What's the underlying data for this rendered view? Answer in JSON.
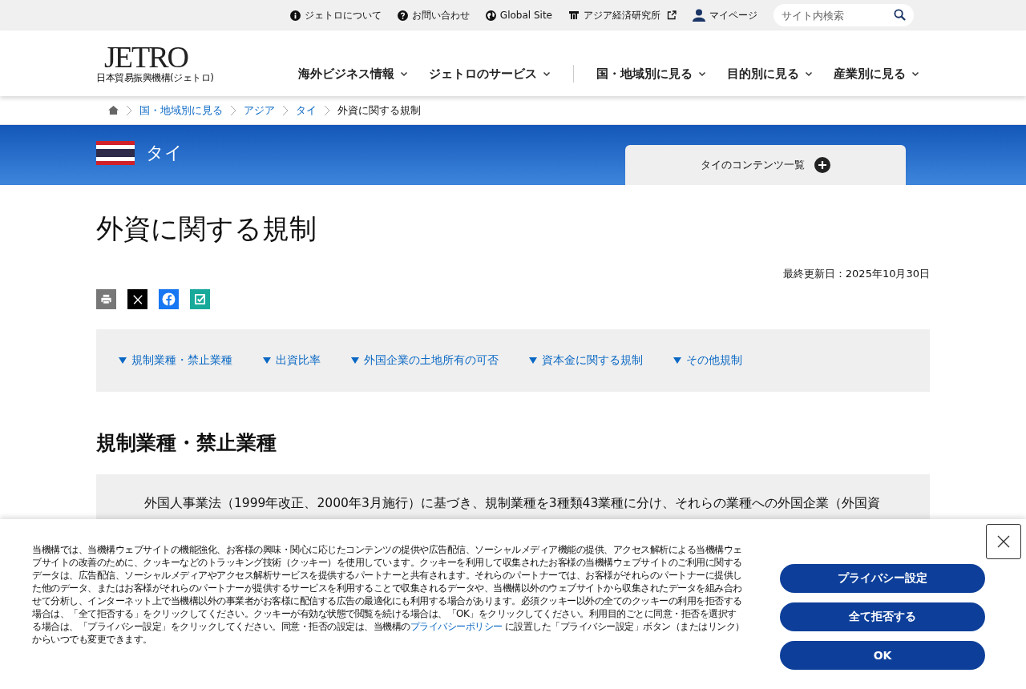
{
  "utility_nav": [
    {
      "kind": "info",
      "label": "ジェトロについて"
    },
    {
      "kind": "help",
      "label": "お問い合わせ"
    },
    {
      "kind": "globe",
      "label": "Global Site"
    },
    {
      "kind": "building",
      "label": "アジア経済研究所",
      "external": true
    },
    {
      "kind": "user",
      "label": "マイページ"
    }
  ],
  "search": {
    "placeholder": "サイト内検索"
  },
  "logo": {
    "name": "JETRO",
    "subtitle": "日本貿易振興機構(ジェトロ)"
  },
  "main_nav": [
    {
      "label": "海外ビジネス情報"
    },
    {
      "label": "ジェトロのサービス"
    }
  ],
  "view_nav": [
    {
      "label": "国・地域別に見る"
    },
    {
      "label": "目的別に見る"
    },
    {
      "label": "産業別に見る"
    }
  ],
  "breadcrumb": [
    {
      "label": "国・地域別に見る",
      "link": true
    },
    {
      "label": "アジア",
      "link": true
    },
    {
      "label": "タイ",
      "link": true
    },
    {
      "label": "外資に関する規制",
      "link": false
    }
  ],
  "country": {
    "name": "タイ",
    "contents_button": "タイのコンテンツ一覧"
  },
  "page_title": "外資に関する規制",
  "updated": "最終更新日：2025年10月30日",
  "share": [
    {
      "kind": "print"
    },
    {
      "kind": "x"
    },
    {
      "kind": "facebook"
    },
    {
      "kind": "bookmark"
    }
  ],
  "anchors": [
    "規制業種・禁止業種",
    "出資比率",
    "外国企業の土地所有の可否",
    "資本金に関する規制",
    "その他規制"
  ],
  "section_title": "規制業種・禁止業種",
  "section_text": "外国人事業法（1999年改正、2000年3月施行）に基づき、規制業種を3種類43業種に分け、それらの業種への外国企業（外国資",
  "cookie_banner": {
    "text_before": "当機構では、当機構ウェブサイトの機能強化、お客様の興味・関心に応じたコンテンツの提供や広告配信、ソーシャルメディア機能の提供、アクセス解析による当機構ウェブサイトの改善のために、クッキーなどのトラッキング技術（クッキー）を使用しています。クッキーを利用して収集されたお客様の当機構ウェブサイトのご利用に関するデータは、広告配信、ソーシャルメディアやアクセス解析サービスを提供するパートナーと共有されます。それらのパートナーでは、お客様がそれらのパートナーに提供した他のデータ、またはお客様がそれらのパートナーが提供するサービスを利用することで収集されるデータや、当機構以外のウェブサイトから収集されたデータを組み合わせて分析し、インターネット上で当機構以外の事業者がお客様に配信する広告の最適化にも利用する場合があります。必須クッキー以外の全てのクッキーの利用を拒否する場合は、「全て拒否する」をクリックしてください。クッキーが有効な状態で閲覧を続ける場合は、「OK」をクリックしてください。利用目的ごとに同意・拒否を選択する場合は、「プライバシー設定」をクリックしてください。同意・拒否の設定は、当機構の",
    "link": "プライバシーポリシー",
    "text_after": " に設置した「プライバシー設定」ボタン（またはリンク）からいつでも変更できます。",
    "buttons": [
      "プライバシー設定",
      "全て拒否する",
      "OK"
    ]
  }
}
